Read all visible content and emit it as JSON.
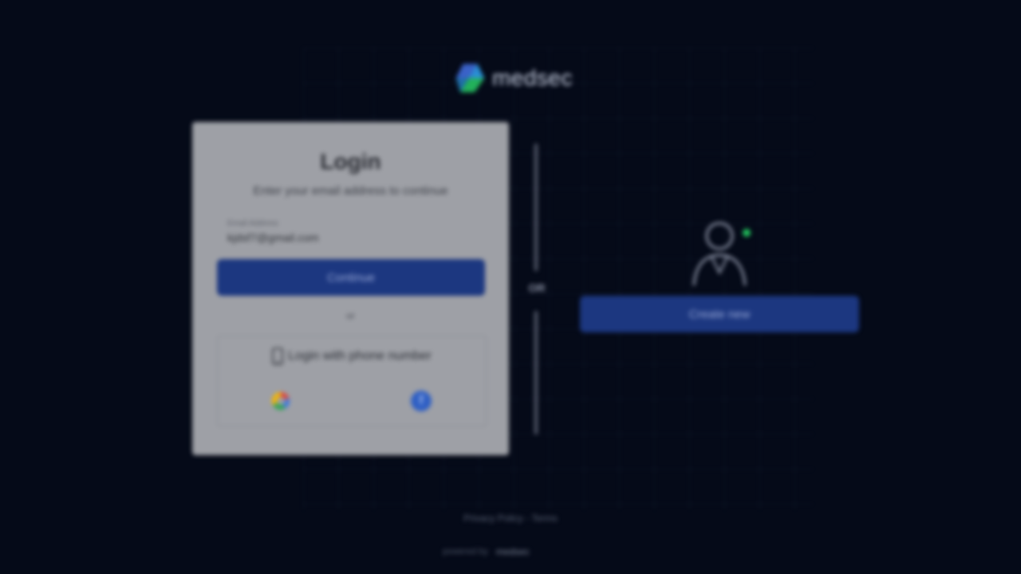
{
  "brand": {
    "name": "medsec"
  },
  "login": {
    "title": "Login",
    "subtitle": "Enter your email address to continue",
    "email_label": "Email Address",
    "email_value": "kjdsf7@gmail.com",
    "continue_label": "Continue",
    "or_label": "or",
    "phone_login_label": "Login with phone number"
  },
  "divider": {
    "label": "OR"
  },
  "signup": {
    "create_label": "Create new"
  },
  "footer": {
    "link_label": "Privacy Policy - Terms",
    "powered_by": "powered by",
    "powered_brand": "medsec"
  },
  "colors": {
    "background": "#050a18",
    "card": "#9ea0a6",
    "primary_button": "#1c3780",
    "accent_green": "#22c55e"
  },
  "icons": [
    "medsec-logo-icon",
    "phone-icon",
    "google-icon",
    "facebook-icon",
    "doctor-avatar-icon"
  ]
}
